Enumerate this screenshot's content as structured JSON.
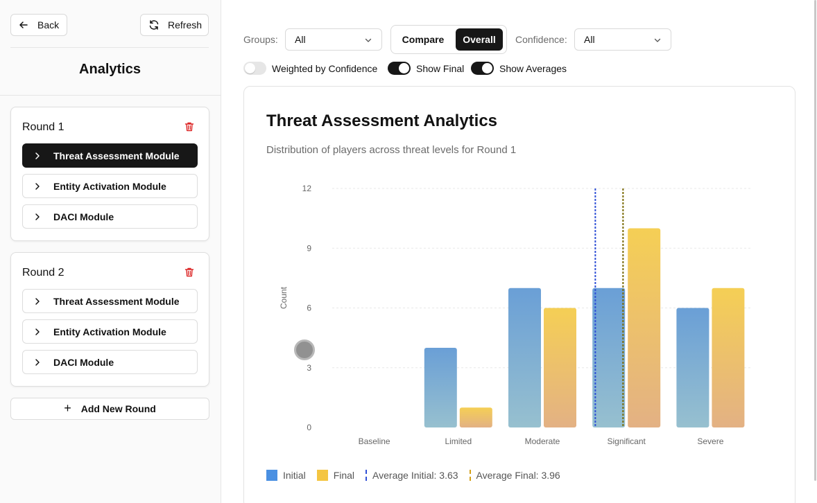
{
  "sidebar": {
    "back_label": "Back",
    "refresh_label": "Refresh",
    "title": "Analytics",
    "rounds": [
      {
        "title": "Round 1",
        "modules": [
          {
            "label": "Threat Assessment Module",
            "active": true
          },
          {
            "label": "Entity Activation Module",
            "active": false
          },
          {
            "label": "DACI Module",
            "active": false
          }
        ]
      },
      {
        "title": "Round 2",
        "modules": [
          {
            "label": "Threat Assessment Module",
            "active": false
          },
          {
            "label": "Entity Activation Module",
            "active": false
          },
          {
            "label": "DACI Module",
            "active": false
          }
        ]
      }
    ],
    "add_round_label": "Add New Round"
  },
  "controls": {
    "groups_label": "Groups:",
    "groups_value": "All",
    "compare_label": "Compare",
    "overall_label": "Overall",
    "selected_view": "Overall",
    "confidence_label": "Confidence:",
    "confidence_value": "All",
    "toggles": [
      {
        "label": "Weighted by Confidence",
        "on": false
      },
      {
        "label": "Show Final",
        "on": true
      },
      {
        "label": "Show Averages",
        "on": true
      }
    ]
  },
  "chart": {
    "title": "Threat Assessment Analytics",
    "subtitle": "Distribution of players across threat levels for Round 1"
  },
  "chart_data": {
    "type": "bar",
    "categories": [
      "Baseline",
      "Limited",
      "Moderate",
      "Significant",
      "Severe"
    ],
    "series": [
      {
        "name": "Initial",
        "values": [
          0,
          4,
          7,
          7,
          6
        ]
      },
      {
        "name": "Final",
        "values": [
          0,
          1,
          6,
          10,
          7
        ]
      }
    ],
    "ylabel": "Count",
    "ylim": [
      0,
      12
    ],
    "yticks": [
      0,
      3,
      6,
      9,
      12
    ],
    "grid": true,
    "averages": [
      {
        "label": "Average Initial: 3.63",
        "value": 3.63,
        "color": "#2f4fd6"
      },
      {
        "label": "Average Final: 3.96",
        "value": 3.96,
        "color": "#7a6a00"
      }
    ],
    "legend": [
      "Initial",
      "Final",
      "Average Initial: 3.63",
      "Average Final: 3.96"
    ],
    "legend_position": "bottom-left"
  },
  "colors": {
    "initial_top": "#6a9fd6",
    "initial_bottom": "#97c0cf",
    "final_top": "#f5cf55",
    "final_bottom": "#e3b184",
    "legend_initial": "#4a90e2",
    "legend_final": "#f4c542",
    "avg_initial_line": "#2f4fd6",
    "avg_final_line": "#d4a017",
    "delete_red": "#dc2626",
    "active_bg": "#171717"
  },
  "icons": {
    "back": "arrow-left-icon",
    "refresh": "refresh-icon",
    "delete": "trash-icon",
    "expand": "chevron-right-icon",
    "add": "plus-icon",
    "dropdown": "chevron-down-icon"
  }
}
